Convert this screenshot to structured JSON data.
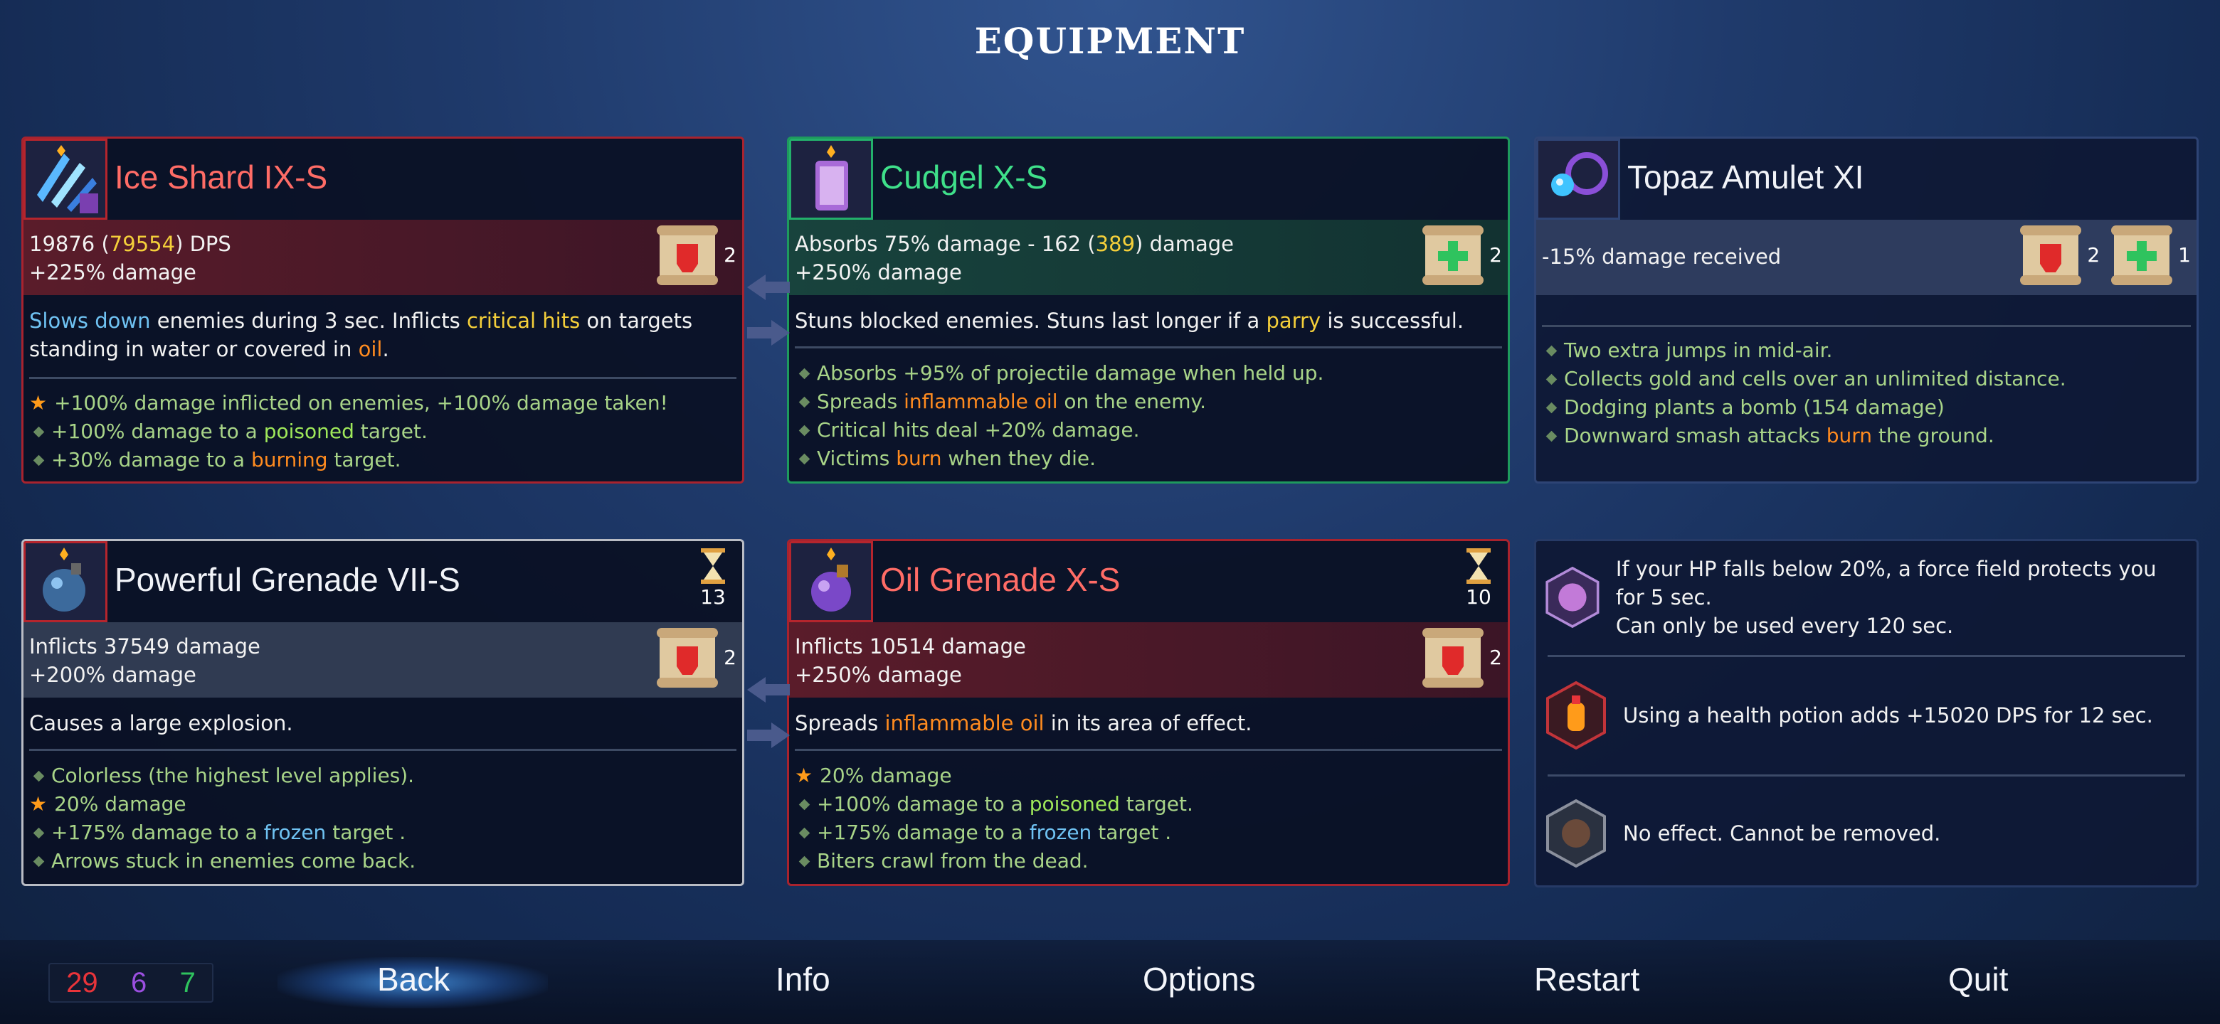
{
  "screen_title": "EQUIPMENT",
  "colors": {
    "red_border": "#a8232e",
    "green_border": "#1e9a5d",
    "keyword_blue": "#6fc2f2",
    "keyword_yellow": "#f4cf3a",
    "keyword_orange": "#ff8b1f",
    "mod_green": "#a8d488"
  },
  "slots": {
    "ice_shard": {
      "icon": "ice-shard-icon",
      "name": "Ice Shard IX-S",
      "dps_main": "19876 (",
      "dps_alt": "79554",
      "dps_tail": ") DPS",
      "damage_bonus": "+225% damage",
      "scroll_count": "2",
      "desc_1": "Slows down",
      "desc_2": " enemies during 3 sec. Inflicts ",
      "desc_3": "critical hits",
      "desc_4": " on targets standing in water or covered in ",
      "desc_5": "oil",
      "desc_6": ".",
      "mod_1": "+100% damage inflicted on enemies, +100% damage taken!",
      "mod_2a": "+100% damage to a ",
      "mod_2b": "poisoned",
      "mod_2c": " target.",
      "mod_3a": "+30% damage to a ",
      "mod_3b": "burning",
      "mod_3c": " target."
    },
    "cudgel": {
      "icon": "cudgel-shield-icon",
      "name": "Cudgel X-S",
      "absorb_main": "Absorbs 75% damage - 162 (",
      "absorb_alt": "389",
      "absorb_tail": ") damage",
      "damage_bonus": "+250% damage",
      "scroll_count": "2",
      "desc_1": "Stuns blocked enemies. Stuns last longer if a ",
      "desc_2": "parry",
      "desc_3": " is successful.",
      "mod_1": "Absorbs +95% of projectile damage when held up.",
      "mod_2a": "Spreads ",
      "mod_2b": "inflammable oil",
      "mod_2c": " on the enemy.",
      "mod_3": "Critical hits deal +20% damage.",
      "mod_4a": "Victims ",
      "mod_4b": "burn",
      "mod_4c": " when they die."
    },
    "amulet": {
      "icon": "topaz-amulet-icon",
      "name": "Topaz Amulet XI",
      "stat": "-15% damage received",
      "scroll_red_count": "2",
      "scroll_green_count": "1",
      "mod_1": "Two extra jumps in mid-air.",
      "mod_2": "Collects gold and cells over an unlimited distance.",
      "mod_3": "Dodging plants a bomb (154 damage)",
      "mod_4a": "Downward smash attacks ",
      "mod_4b": "burn",
      "mod_4c": " the ground."
    },
    "powerful_grenade": {
      "icon": "grenade-icon",
      "name": "Powerful Grenade VII-S",
      "cooldown": "13",
      "stat": "Inflicts 37549 damage",
      "damage_bonus": "+200% damage",
      "scroll_count": "2",
      "desc": "Causes a large explosion.",
      "mod_1": "Colorless (the highest level applies).",
      "mod_2": "20% damage",
      "mod_3a": "+175% damage to a ",
      "mod_3b": "frozen",
      "mod_3c": " target .",
      "mod_4": "Arrows stuck in enemies come back."
    },
    "oil_grenade": {
      "icon": "oil-grenade-icon",
      "name": "Oil Grenade X-S",
      "cooldown": "10",
      "stat": "Inflicts 10514 damage",
      "damage_bonus": "+250% damage",
      "scroll_count": "2",
      "desc_1": "Spreads ",
      "desc_2": "inflammable oil",
      "desc_3": " in its area of effect.",
      "mod_1": "20% damage",
      "mod_2a": "+100% damage to a ",
      "mod_2b": "poisoned",
      "mod_2c": " target.",
      "mod_3a": "+175% damage to a ",
      "mod_3b": "frozen",
      "mod_3c": " target .",
      "mod_4": "Biters crawl from the dead."
    }
  },
  "mutations": [
    {
      "icon": "force-field-mutation-icon",
      "text_1": "If your HP falls below 20%, a force field protects you for 5 sec.",
      "text_2": "Can only be used every 120 sec."
    },
    {
      "icon": "health-potion-mutation-icon",
      "text_1": "Using a health potion adds +15020 DPS for 12 sec."
    },
    {
      "icon": "empty-mutation-icon",
      "text_1": "No effect. Cannot be removed."
    }
  ],
  "scroll_stats": {
    "brutality": "29",
    "tactics": "6",
    "survival": "7",
    "brutality_color": "#e8343a",
    "tactics_color": "#9b4fe0",
    "survival_color": "#2fc35e"
  },
  "menu": {
    "back": "Back",
    "info": "Info",
    "options": "Options",
    "restart": "Restart",
    "quit": "Quit"
  }
}
